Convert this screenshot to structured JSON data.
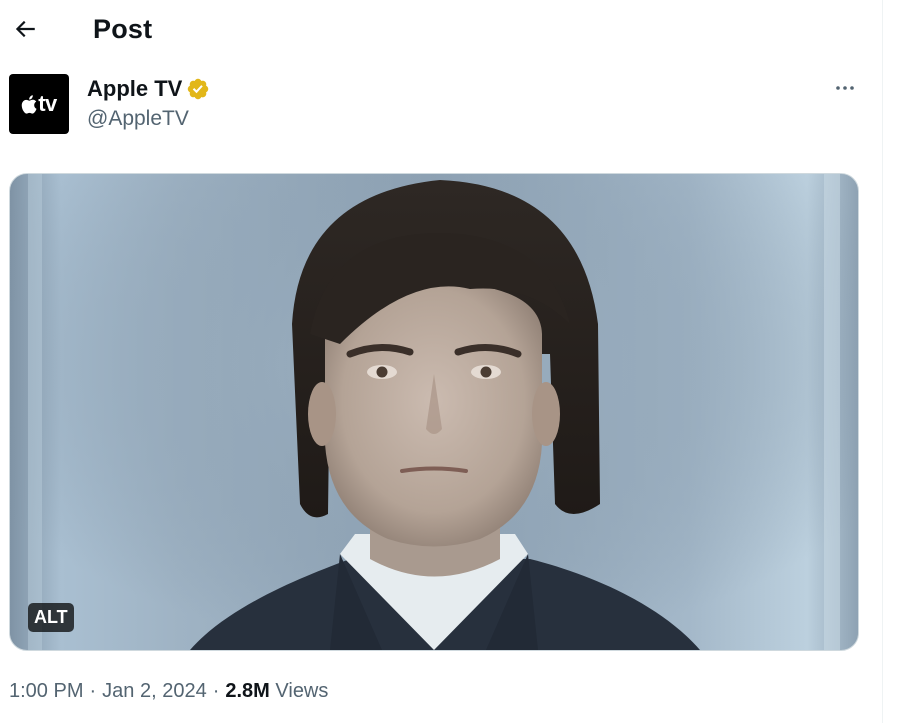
{
  "header": {
    "title": "Post",
    "back_icon": "arrow-left-icon"
  },
  "author": {
    "avatar_text": "tv",
    "avatar_icon": "apple-logo-icon",
    "name": "Apple TV",
    "verified_icon": "verified-badge-icon",
    "verified_color": "#e2b719",
    "handle": "@AppleTV",
    "more_icon": "more-horizontal-icon"
  },
  "media": {
    "alt_label": "ALT"
  },
  "meta": {
    "time": "1:00 PM",
    "separator": "·",
    "date": "Jan 2, 2024",
    "views_count": "2.8M",
    "views_label": "Views"
  },
  "colors": {
    "text_primary": "#0f1419",
    "text_secondary": "#536471",
    "border": "#eff3f4"
  }
}
